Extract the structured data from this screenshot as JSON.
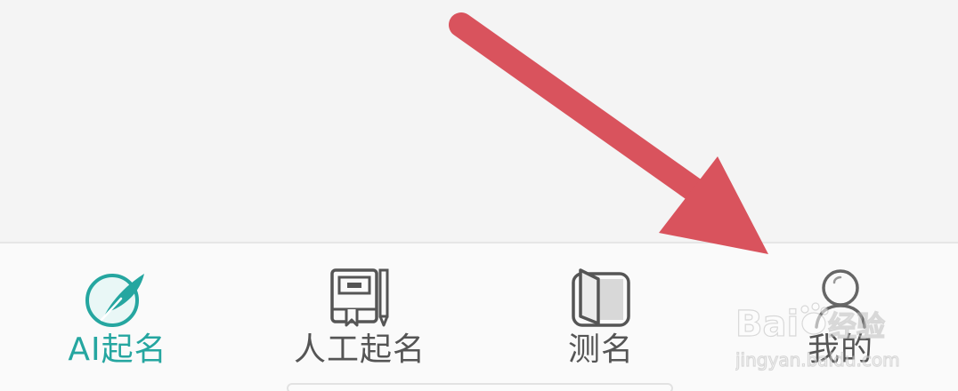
{
  "tabbar": {
    "tabs": [
      {
        "label": "AI起名",
        "icon": "feather-quill-icon",
        "active": true
      },
      {
        "label": "人工起名",
        "icon": "book-pencil-icon",
        "active": false
      },
      {
        "label": "测名",
        "icon": "open-book-icon",
        "active": false
      },
      {
        "label": "我的",
        "icon": "user-profile-icon",
        "active": false
      }
    ]
  },
  "colors": {
    "accent": "#25a6a0",
    "inactive": "#555555",
    "arrow": "#d9535d",
    "background": "#f4f4f4"
  },
  "watermark": {
    "brand_latin": "Bai",
    "brand_suffix": "du",
    "brand_cn": "经验",
    "site": "jingyan.baidu.com"
  }
}
